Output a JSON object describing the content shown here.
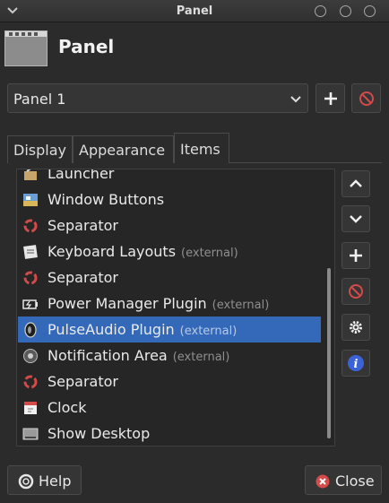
{
  "window": {
    "title": "Panel"
  },
  "header": {
    "title": "Panel"
  },
  "panel_selector": {
    "selected": "Panel 1"
  },
  "tabs": [
    {
      "label": "Display",
      "active": false
    },
    {
      "label": "Appearance",
      "active": false
    },
    {
      "label": "Items",
      "active": true
    }
  ],
  "items": [
    {
      "label": "Launcher",
      "external": "",
      "icon": "launcher-icon",
      "selected": false
    },
    {
      "label": "Window Buttons",
      "external": "",
      "icon": "window-buttons-icon",
      "selected": false
    },
    {
      "label": "Separator",
      "external": "",
      "icon": "separator-icon",
      "selected": false
    },
    {
      "label": "Keyboard Layouts",
      "external": "(external)",
      "icon": "keyboard-layouts-icon",
      "selected": false
    },
    {
      "label": "Separator",
      "external": "",
      "icon": "separator-icon",
      "selected": false
    },
    {
      "label": "Power Manager Plugin",
      "external": "(external)",
      "icon": "battery-icon",
      "selected": false
    },
    {
      "label": "PulseAudio Plugin",
      "external": "(external)",
      "icon": "speaker-icon",
      "selected": true
    },
    {
      "label": "Notification Area",
      "external": "(external)",
      "icon": "notification-area-icon",
      "selected": false
    },
    {
      "label": "Separator",
      "external": "",
      "icon": "separator-icon",
      "selected": false
    },
    {
      "label": "Clock",
      "external": "",
      "icon": "calendar-icon",
      "selected": false
    },
    {
      "label": "Show Desktop",
      "external": "",
      "icon": "show-desktop-icon",
      "selected": false
    }
  ],
  "footer": {
    "help_label": "Help",
    "close_label": "Close"
  },
  "colors": {
    "background": "#2b2b2b",
    "selection": "#3469b9",
    "danger": "#d34a4a",
    "info": "#3b63d6"
  }
}
